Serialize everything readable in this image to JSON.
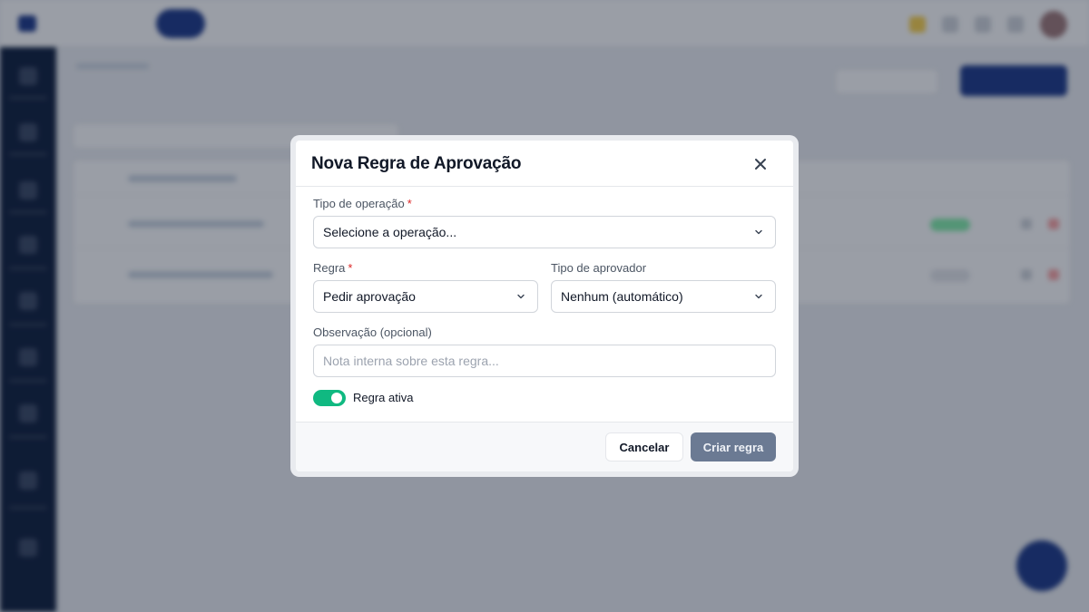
{
  "modal": {
    "title": "Nova Regra de Aprovação",
    "close_icon": "close-icon",
    "fields": {
      "operation_type": {
        "label": "Tipo de operação",
        "required_mark": "*",
        "value": "Selecione a operação..."
      },
      "rule": {
        "label": "Regra",
        "required_mark": "*",
        "value": "Pedir aprovação"
      },
      "approver_type": {
        "label": "Tipo de aprovador",
        "value": "Nenhum (automático)"
      },
      "note": {
        "label": "Observação (opcional)",
        "value": "",
        "placeholder": "Nota interna sobre esta regra..."
      }
    },
    "active_toggle": {
      "label": "Regra ativa",
      "on": true
    },
    "footer": {
      "cancel_label": "Cancelar",
      "create_label": "Criar regra"
    }
  },
  "colors": {
    "toggle_on": "#10b981",
    "primary_disabled": "#6b7a93",
    "required": "#dc2626",
    "sidebar": "#0f1f3d",
    "accent": "#1e3a8a"
  }
}
